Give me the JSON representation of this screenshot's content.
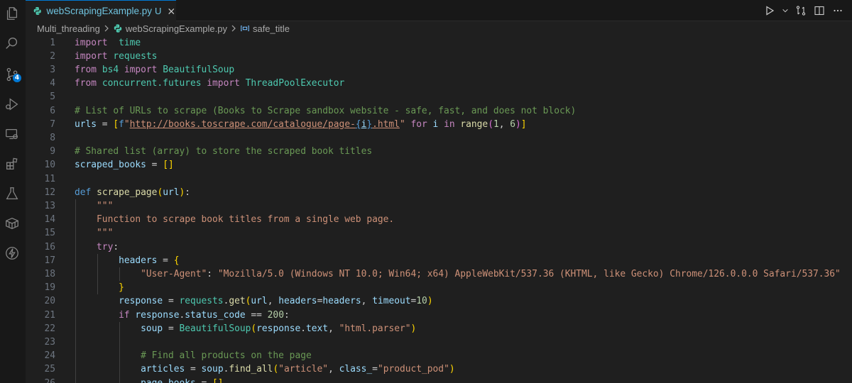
{
  "tab": {
    "filename": "webScrapingExample.py",
    "status": "U"
  },
  "breadcrumb": {
    "folder": "Multi_threading",
    "file": "webScrapingExample.py",
    "symbol": "safe_title"
  },
  "scm_badge": "4",
  "colors": {
    "accent": "#0078d4",
    "keyword": "#c586c0",
    "storage": "#569cd6",
    "module": "#4ec9b0",
    "variable": "#9cdcfe",
    "function": "#dcdcaa",
    "string": "#ce9178",
    "number": "#b5cea8",
    "comment": "#6a9955"
  },
  "icons": [
    "explorer-icon",
    "search-icon",
    "source-control-icon",
    "run-debug-icon",
    "remote-explorer-icon",
    "extensions-icon",
    "testing-icon",
    "containers-icon",
    "thunder-client-icon"
  ],
  "lines": [
    {
      "n": "1",
      "tokens": [
        [
          "kw",
          "import"
        ],
        [
          "",
          "  "
        ],
        [
          "mod",
          "time"
        ]
      ]
    },
    {
      "n": "2",
      "tokens": [
        [
          "kw",
          "import"
        ],
        [
          "",
          ""
        ],
        [
          "mod",
          " requests"
        ]
      ]
    },
    {
      "n": "3",
      "tokens": [
        [
          "kw",
          "from"
        ],
        [
          "",
          " "
        ],
        [
          "mod",
          "bs4"
        ],
        [
          "",
          " "
        ],
        [
          "kw",
          "import"
        ],
        [
          "",
          " "
        ],
        [
          "mod",
          "BeautifulSoup"
        ]
      ]
    },
    {
      "n": "4",
      "tokens": [
        [
          "kw",
          "from"
        ],
        [
          "",
          " "
        ],
        [
          "mod",
          "concurrent.futures"
        ],
        [
          "",
          " "
        ],
        [
          "kw",
          "import"
        ],
        [
          "",
          " "
        ],
        [
          "mod",
          "ThreadPoolExecutor"
        ]
      ]
    },
    {
      "n": "5",
      "tokens": []
    },
    {
      "n": "6",
      "tokens": [
        [
          "cm",
          "# List of URLs to scrape (Books to Scrape sandbox website - safe, fast, and does not block)"
        ]
      ]
    },
    {
      "n": "7",
      "tokens": [
        [
          "var",
          "urls"
        ],
        [
          "",
          " = "
        ],
        [
          "br1",
          "["
        ],
        [
          "kw2",
          "f"
        ],
        [
          "str",
          "\""
        ],
        [
          "str url",
          "http://books.toscrape.com/catalogue/page-"
        ],
        [
          "kw2 url",
          "{"
        ],
        [
          "var url",
          "i"
        ],
        [
          "kw2 url",
          "}"
        ],
        [
          "str url",
          ".html"
        ],
        [
          "str",
          "\""
        ],
        [
          "",
          " "
        ],
        [
          "kw",
          "for"
        ],
        [
          "",
          " "
        ],
        [
          "var",
          "i"
        ],
        [
          "",
          " "
        ],
        [
          "kw",
          "in"
        ],
        [
          "",
          " "
        ],
        [
          "fn",
          "range"
        ],
        [
          "br2",
          "("
        ],
        [
          "num",
          "1"
        ],
        [
          "",
          ", "
        ],
        [
          "num",
          "6"
        ],
        [
          "br2",
          ")"
        ],
        [
          "br1",
          "]"
        ]
      ]
    },
    {
      "n": "8",
      "tokens": []
    },
    {
      "n": "9",
      "tokens": [
        [
          "cm",
          "# Shared list (array) to store the scraped book titles"
        ]
      ]
    },
    {
      "n": "10",
      "tokens": [
        [
          "var",
          "scraped_books"
        ],
        [
          "",
          " = "
        ],
        [
          "br1",
          "[]"
        ]
      ]
    },
    {
      "n": "11",
      "tokens": []
    },
    {
      "n": "12",
      "tokens": [
        [
          "kw2",
          "def"
        ],
        [
          "",
          " "
        ],
        [
          "fn",
          "scrape_page"
        ],
        [
          "br1",
          "("
        ],
        [
          "var",
          "url"
        ],
        [
          "br1",
          ")"
        ],
        [
          "",
          ":"
        ]
      ]
    },
    {
      "n": "13",
      "tokens": [
        [
          "",
          "    "
        ],
        [
          "str",
          "\"\"\""
        ]
      ]
    },
    {
      "n": "14",
      "tokens": [
        [
          "",
          "    "
        ],
        [
          "str",
          "Function to scrape book titles from a single web page."
        ]
      ]
    },
    {
      "n": "15",
      "tokens": [
        [
          "",
          "    "
        ],
        [
          "str",
          "\"\"\""
        ]
      ]
    },
    {
      "n": "16",
      "tokens": [
        [
          "",
          "    "
        ],
        [
          "kw",
          "try"
        ],
        [
          "",
          ":"
        ]
      ]
    },
    {
      "n": "17",
      "tokens": [
        [
          "",
          "        "
        ],
        [
          "var",
          "headers"
        ],
        [
          "",
          " = "
        ],
        [
          "br1",
          "{"
        ]
      ]
    },
    {
      "n": "18",
      "tokens": [
        [
          "",
          "            "
        ],
        [
          "str",
          "\"User-Agent\""
        ],
        [
          "",
          ": "
        ],
        [
          "str",
          "\"Mozilla/5.0 (Windows NT 10.0; Win64; x64) AppleWebKit/537.36 (KHTML, like Gecko) Chrome/126.0.0.0 Safari/537.36\""
        ]
      ]
    },
    {
      "n": "19",
      "tokens": [
        [
          "",
          "        "
        ],
        [
          "br1",
          "}"
        ]
      ]
    },
    {
      "n": "20",
      "tokens": [
        [
          "",
          "        "
        ],
        [
          "var",
          "response"
        ],
        [
          "",
          " = "
        ],
        [
          "mod",
          "requests"
        ],
        [
          "",
          "."
        ],
        [
          "fn",
          "get"
        ],
        [
          "br1",
          "("
        ],
        [
          "var",
          "url"
        ],
        [
          "",
          ", "
        ],
        [
          "var",
          "headers"
        ],
        [
          "",
          "="
        ],
        [
          "var",
          "headers"
        ],
        [
          "",
          ", "
        ],
        [
          "var",
          "timeout"
        ],
        [
          "",
          "="
        ],
        [
          "num",
          "10"
        ],
        [
          "br1",
          ")"
        ]
      ]
    },
    {
      "n": "21",
      "tokens": [
        [
          "",
          "        "
        ],
        [
          "kw",
          "if"
        ],
        [
          "",
          " "
        ],
        [
          "var",
          "response"
        ],
        [
          "",
          "."
        ],
        [
          "var",
          "status_code"
        ],
        [
          "",
          " == "
        ],
        [
          "num",
          "200"
        ],
        [
          "",
          ":"
        ]
      ]
    },
    {
      "n": "22",
      "tokens": [
        [
          "",
          "            "
        ],
        [
          "var",
          "soup"
        ],
        [
          "",
          " = "
        ],
        [
          "mod",
          "BeautifulSoup"
        ],
        [
          "br1",
          "("
        ],
        [
          "var",
          "response"
        ],
        [
          "",
          "."
        ],
        [
          "var",
          "text"
        ],
        [
          "",
          ", "
        ],
        [
          "str",
          "\"html.parser\""
        ],
        [
          "br1",
          ")"
        ]
      ]
    },
    {
      "n": "23",
      "tokens": []
    },
    {
      "n": "24",
      "tokens": [
        [
          "",
          "            "
        ],
        [
          "cm",
          "# Find all products on the page"
        ]
      ]
    },
    {
      "n": "25",
      "tokens": [
        [
          "",
          "            "
        ],
        [
          "var",
          "articles"
        ],
        [
          "",
          " = "
        ],
        [
          "var",
          "soup"
        ],
        [
          "",
          "."
        ],
        [
          "fn",
          "find_all"
        ],
        [
          "br1",
          "("
        ],
        [
          "str",
          "\"article\""
        ],
        [
          "",
          ", "
        ],
        [
          "var",
          "class_"
        ],
        [
          "",
          "="
        ],
        [
          "str",
          "\"product_pod\""
        ],
        [
          "br1",
          ")"
        ]
      ]
    },
    {
      "n": "26",
      "tokens": [
        [
          "",
          "            "
        ],
        [
          "var",
          "page_books"
        ],
        [
          "",
          " = "
        ],
        [
          "br1",
          "[]"
        ]
      ]
    }
  ]
}
